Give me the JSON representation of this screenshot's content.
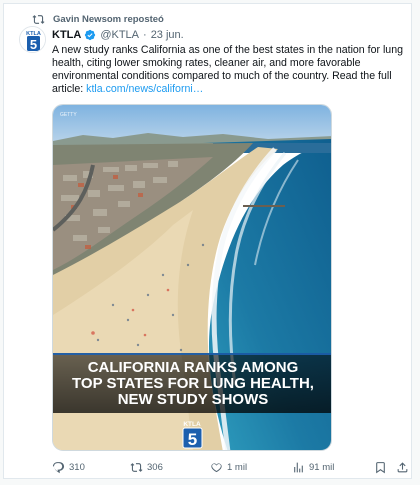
{
  "repost": {
    "label": "Gavin Newsom reposteó"
  },
  "author": {
    "name": "KTLA",
    "handle": "@KTLA",
    "date": "23 jun.",
    "separator": "·"
  },
  "tweet": {
    "text": "A new study ranks California as one of the best states in the nation for lung health, citing lower smoking rates, cleaner air, and more favorable environmental conditions compared to much of the country. Read the full article:",
    "link": "ktla.com/news/californi…"
  },
  "media": {
    "credit": "GETTY",
    "headline_line1": "CALIFORNIA RANKS AMONG",
    "headline_line2": "TOP STATES FOR LUNG HEALTH,",
    "headline_line3": "NEW STUDY SHOWS",
    "logo_text": "KTLA",
    "logo_number": "5"
  },
  "actions": {
    "replies": "310",
    "reposts": "306",
    "likes": "1 mil",
    "views": "91 mil"
  },
  "colors": {
    "accent": "#1d9bf0",
    "muted": "#536471",
    "repost_green": "#00ba7c"
  }
}
